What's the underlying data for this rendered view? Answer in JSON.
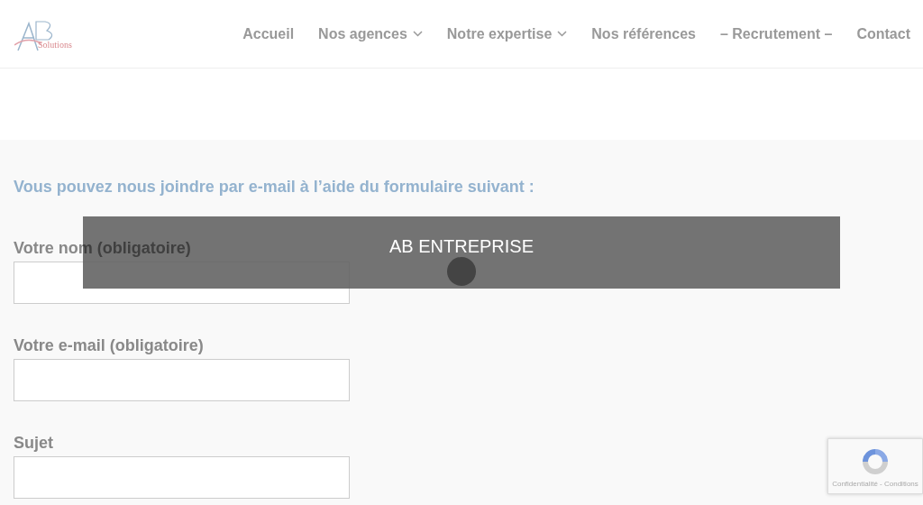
{
  "logo": {
    "text": "Solutions"
  },
  "nav": [
    {
      "label": "Accueil",
      "dropdown": false
    },
    {
      "label": "Nos agences",
      "dropdown": true
    },
    {
      "label": "Notre expertise",
      "dropdown": true
    },
    {
      "label": "Nos références",
      "dropdown": false
    },
    {
      "label": "– Recrutement –",
      "dropdown": false
    },
    {
      "label": "Contact",
      "dropdown": false
    }
  ],
  "intro": "Vous pouvez nous joindre par e-mail à l’aide du formulaire suivant :",
  "fields": [
    {
      "label": "Votre nom (obligatoire)"
    },
    {
      "label": "Votre e-mail (obligatoire)"
    },
    {
      "label": "Sujet"
    }
  ],
  "overlay": {
    "title": "AB ENTREPRISE"
  },
  "recaptcha": {
    "text": "Confidentialité - Conditions"
  }
}
